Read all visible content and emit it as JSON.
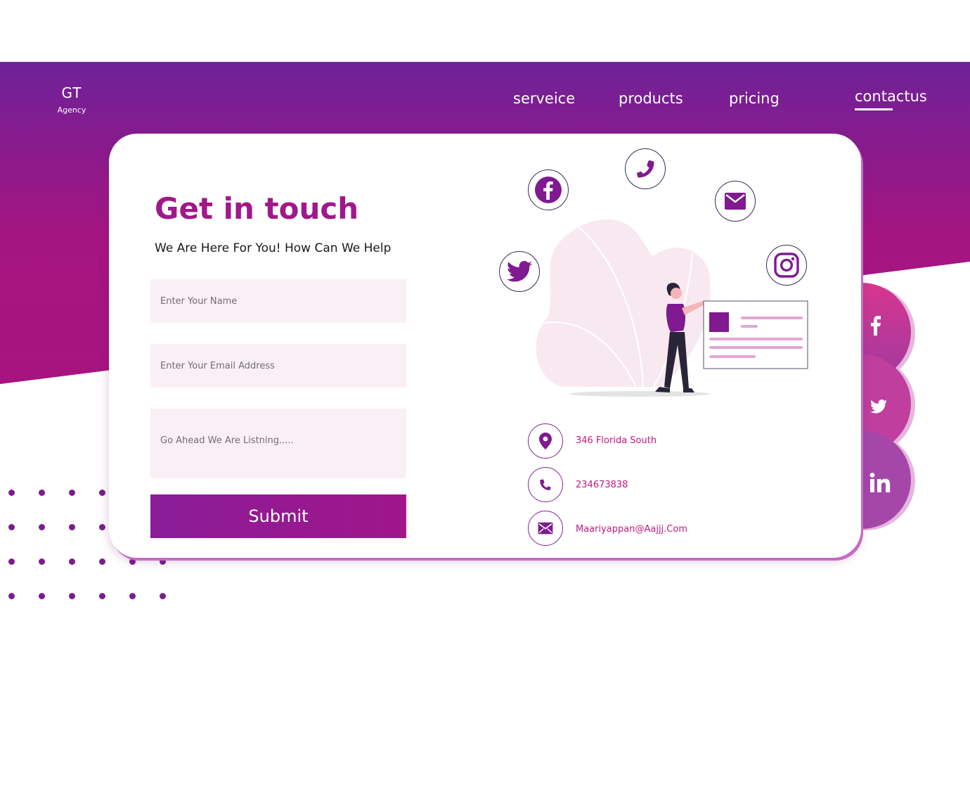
{
  "brand": {
    "name": "GT",
    "tagline": "Agency"
  },
  "nav": [
    {
      "label": "serveice",
      "active": false
    },
    {
      "label": "products",
      "active": false
    },
    {
      "label": "pricing",
      "active": false
    },
    {
      "label": "contactus",
      "active": true
    }
  ],
  "contact_form": {
    "title": "Get in touch",
    "subtitle": "We Are Here For You! How Can We Help",
    "name_placeholder": "Enter Your Name",
    "email_placeholder": "Enter Your Email Address",
    "message_placeholder": "Go Ahead We Are Listning.....",
    "submit_label": "Submit"
  },
  "contact_info": {
    "address": "346 Florida South",
    "phone": "234673838",
    "email": "Maariyappan@Aajjj.Com"
  },
  "floating_icons": [
    "facebook-icon",
    "phone-icon",
    "mail-icon",
    "twitter-icon",
    "instagram-icon"
  ],
  "side_social": [
    "facebook-icon",
    "twitter-icon",
    "linkedin-icon"
  ],
  "colors": {
    "gradient_top": "#6f2198",
    "gradient_bottom": "#a51581",
    "accent": "#a0188a",
    "link_text": "#c2187e",
    "field_bg": "#fbeff6",
    "dots": "#7b1c8e"
  }
}
